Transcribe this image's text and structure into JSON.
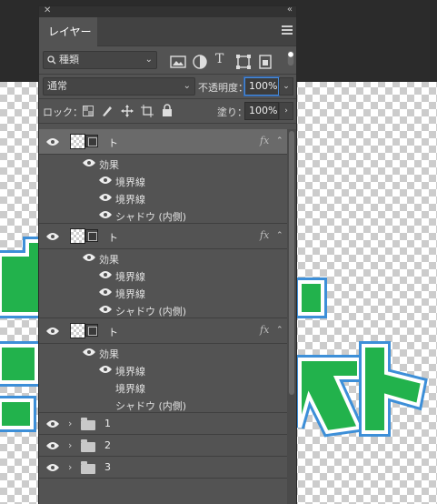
{
  "panel": {
    "close_glyph": "✕",
    "collapse_glyph": "«",
    "tab_label": "レイヤー",
    "filter": {
      "label": "種類",
      "icon": "search-icon"
    },
    "blend_mode": "通常",
    "opacity_label": "不透明度：",
    "opacity_value": "100%",
    "lock_label": "ロック：",
    "fill_label": "塗り：",
    "fill_value": "100%"
  },
  "layers": [
    {
      "name": "ト",
      "fx": "fx",
      "effects_label": "効果",
      "effects": [
        "境界線",
        "境界線",
        "シャドウ (内側)"
      ],
      "effects_visible": [
        true,
        true,
        true
      ]
    },
    {
      "name": "ト",
      "fx": "fx",
      "effects_label": "効果",
      "effects": [
        "境界線",
        "境界線",
        "シャドウ (内側)"
      ],
      "effects_visible": [
        true,
        true,
        true
      ]
    },
    {
      "name": "ト",
      "fx": "fx",
      "effects_label": "効果",
      "effects": [
        "境界線",
        "境界線",
        "シャドウ (内側)"
      ],
      "effects_visible": [
        true,
        false,
        false
      ]
    }
  ],
  "groups": [
    {
      "name": "1"
    },
    {
      "name": "2"
    },
    {
      "name": "3"
    }
  ],
  "colors": {
    "accent": "#4a8ad6",
    "text_green": "#22b24c",
    "text_outline_blue": "#3d8fd8"
  }
}
